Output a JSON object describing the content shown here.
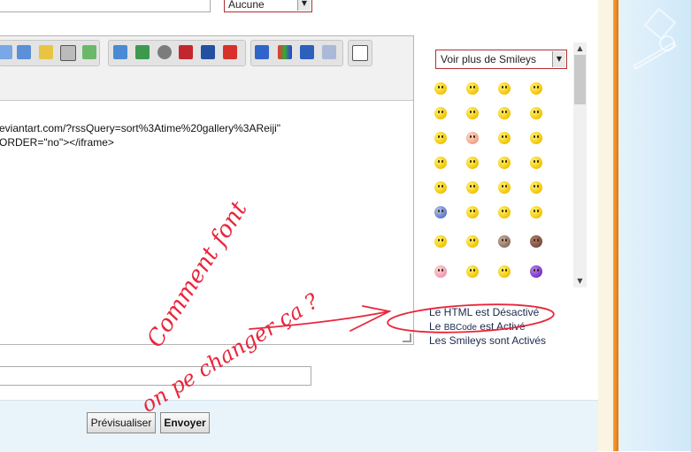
{
  "header": {
    "select_value": "Aucune"
  },
  "editor": {
    "line1": "eviantart.com/?rssQuery=sort%3Atime%20gallery%3AReiji\"",
    "line2": "ORDER=\"no\"></iframe>"
  },
  "smileys": {
    "more_select": "Voir plus de Smileys",
    "grid": [
      "smile-icon",
      "happy-icon",
      "grin-icon",
      "wink-icon",
      "eek-icon",
      "cool-icon",
      "laugh-icon",
      "tongue-icon",
      "blush-icon",
      "pink-face-icon",
      "sad-icon",
      "evil-icon",
      "devil-icon",
      "sunglasses-icon",
      "shy-icon",
      "exclaim-icon",
      "question-icon",
      "idea-icon",
      "neutral-icon",
      "confused-icon",
      "rolleyes-icon",
      "mad-icon",
      "twisted-icon",
      "angry-icon",
      "unsure-icon",
      "worried-icon",
      "cat-icon",
      "dark-face-icon",
      "pig-icon",
      "dizzy-icon",
      "sleepy-icon",
      "purple-question-icon"
    ]
  },
  "status": {
    "html": "Le HTML est Désactivé",
    "bbcode_prefix": "Le ",
    "bbcode_name": "BBCode",
    "bbcode_suffix": " est Activé",
    "smileys": "Les Smileys sont Activés"
  },
  "buttons": {
    "preview": "Prévisualiser",
    "send": "Envoyer"
  },
  "annotation": {
    "line1": "Comment font",
    "line2": "on pe changer ça ?",
    "color": "#e8263c"
  }
}
